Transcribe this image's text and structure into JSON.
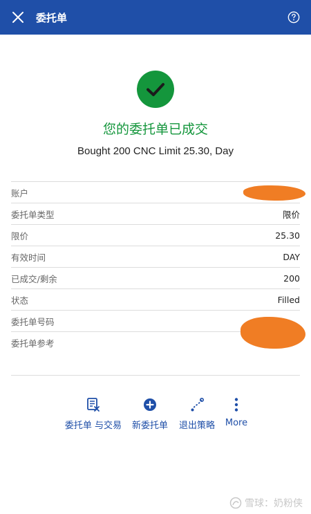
{
  "header": {
    "title": "委托单"
  },
  "status": {
    "title": "您的委托单已成交",
    "description": "Bought 200 CNC Limit 25.30, Day"
  },
  "details": [
    {
      "label": "账户",
      "value": ""
    },
    {
      "label": "委托单类型",
      "value": "限价"
    },
    {
      "label": "限价",
      "value": "25.30"
    },
    {
      "label": "有效时间",
      "value": "DAY"
    },
    {
      "label": "已成交/剩余",
      "value": "200"
    },
    {
      "label": "状态",
      "value": "Filled"
    },
    {
      "label": "委托单号码",
      "value": ""
    },
    {
      "label": "委托单参考",
      "value": ""
    }
  ],
  "actions": [
    {
      "label": "委托单 与交易",
      "icon": "orders-trades-icon"
    },
    {
      "label": "新委托单",
      "icon": "plus-circle-icon"
    },
    {
      "label": "退出策略",
      "icon": "exit-strategy-icon"
    },
    {
      "label": "More",
      "icon": "more-vertical-icon"
    }
  ],
  "watermark": "雪球：奶粉侠",
  "colors": {
    "header_bg": "#1f4fa8",
    "success": "#14963c",
    "accent": "#1f4fa8",
    "redaction": "#f07d24"
  }
}
